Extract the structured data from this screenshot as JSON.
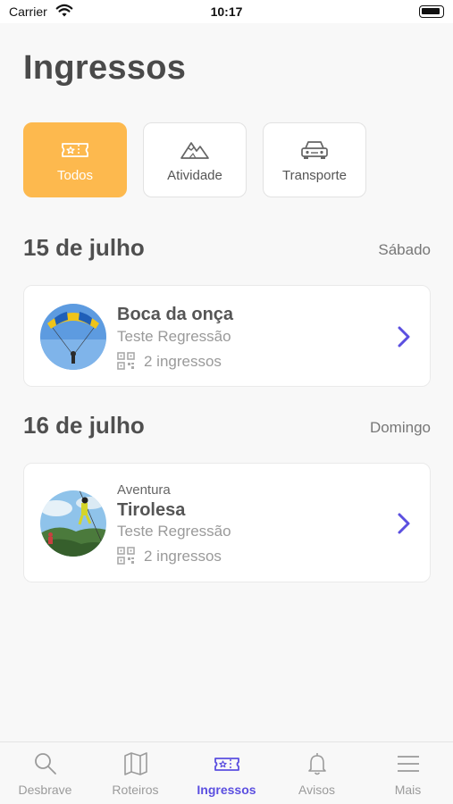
{
  "status_bar": {
    "carrier": "Carrier",
    "time": "10:17"
  },
  "page": {
    "title": "Ingressos"
  },
  "filters": [
    {
      "label": "Todos",
      "icon": "ticket-icon",
      "active": true
    },
    {
      "label": "Atividade",
      "icon": "mountain-icon",
      "active": false
    },
    {
      "label": "Transporte",
      "icon": "car-icon",
      "active": false
    }
  ],
  "days": [
    {
      "date": "15 de julho",
      "weekday": "Sábado",
      "ticket": {
        "category": "",
        "title": "Boca da onça",
        "subtitle": "Teste Regressão",
        "count": "2 ingressos",
        "image": "paraglider-photo"
      }
    },
    {
      "date": "16 de julho",
      "weekday": "Domingo",
      "ticket": {
        "category": "Aventura",
        "title": "Tirolesa",
        "subtitle": "Teste Regressão",
        "count": "2 ingressos",
        "image": "zipline-photo"
      }
    }
  ],
  "tabbar": [
    {
      "label": "Desbrave",
      "icon": "search-icon",
      "active": false
    },
    {
      "label": "Roteiros",
      "icon": "map-icon",
      "active": false
    },
    {
      "label": "Ingressos",
      "icon": "ticket-icon",
      "active": true
    },
    {
      "label": "Avisos",
      "icon": "bell-icon",
      "active": false
    },
    {
      "label": "Mais",
      "icon": "menu-icon",
      "active": false
    }
  ],
  "colors": {
    "accent": "#fdb94e",
    "brand": "#5b4fe0",
    "background": "#f8f8f8"
  }
}
